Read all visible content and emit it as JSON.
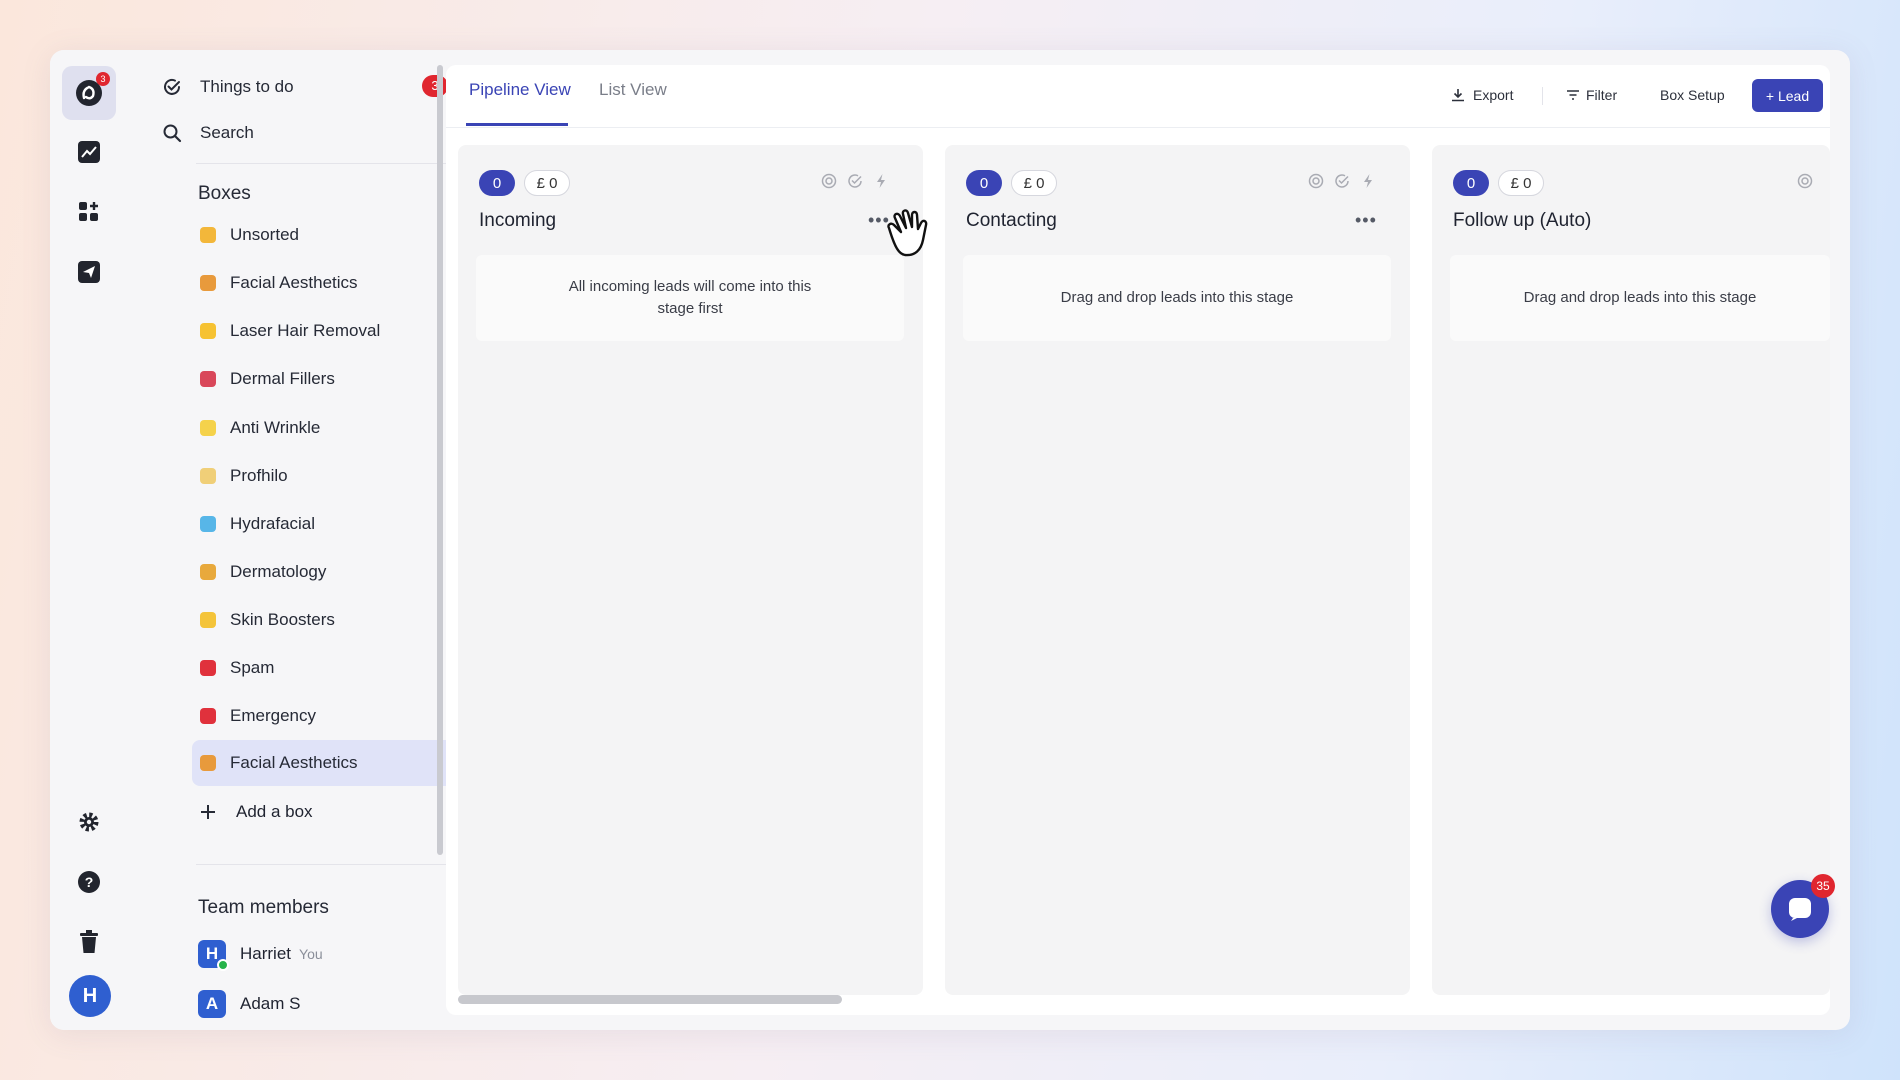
{
  "rail": {
    "logo_badge": "3",
    "avatar_letter": "H"
  },
  "sidebar": {
    "things_to_do": "Things to do",
    "things_to_do_count": "3",
    "search": "Search",
    "boxes_title": "Boxes",
    "boxes": [
      {
        "label": "Unsorted",
        "color": "#f3b73a"
      },
      {
        "label": "Facial Aesthetics",
        "color": "#e89a3c"
      },
      {
        "label": "Laser Hair Removal",
        "color": "#f6c232"
      },
      {
        "label": "Dermal Fillers",
        "color": "#d9475a"
      },
      {
        "label": "Anti Wrinkle",
        "color": "#f5d24b"
      },
      {
        "label": "Profhilo",
        "color": "#f0cf78"
      },
      {
        "label": "Hydrafacial",
        "color": "#57b6e8"
      },
      {
        "label": "Dermatology",
        "color": "#e8a93c"
      },
      {
        "label": "Skin Boosters",
        "color": "#f4c43a"
      },
      {
        "label": "Spam",
        "color": "#e0313c"
      },
      {
        "label": "Emergency",
        "color": "#e0313c"
      },
      {
        "label": "Facial Aesthetics",
        "color": "#e89a3c"
      }
    ],
    "add_box": "Add a box",
    "team_title": "Team members",
    "members": [
      {
        "initial": "H",
        "name": "Harriet",
        "tag": "You"
      },
      {
        "initial": "A",
        "name": "Adam S",
        "tag": ""
      }
    ]
  },
  "tabs": [
    "Pipeline View",
    "List View"
  ],
  "toolbar": {
    "export": "Export",
    "filter": "Filter",
    "box_setup": "Box Setup",
    "add_lead": "+ Lead"
  },
  "columns": [
    {
      "count": "0",
      "value": "£ 0",
      "title": "Incoming",
      "empty_text": "All incoming leads will come into this stage first"
    },
    {
      "count": "0",
      "value": "£ 0",
      "title": "Contacting",
      "empty_text": "Drag and drop leads into this stage"
    },
    {
      "count": "0",
      "value": "£ 0",
      "title": "Follow up (Auto)",
      "empty_text": "Drag and drop leads into this stage"
    }
  ],
  "chat": {
    "badge": "35"
  },
  "icons": [
    "logo-icon",
    "chart-icon",
    "apps-icon",
    "send-icon",
    "gear-icon",
    "help-icon",
    "trash-icon",
    "check-circle-icon",
    "search-icon",
    "plus-icon",
    "download-icon",
    "filter-icon",
    "target-icon",
    "check-icon",
    "bolt-icon",
    "more-icon",
    "hand-cursor-icon",
    "chat-icon"
  ]
}
